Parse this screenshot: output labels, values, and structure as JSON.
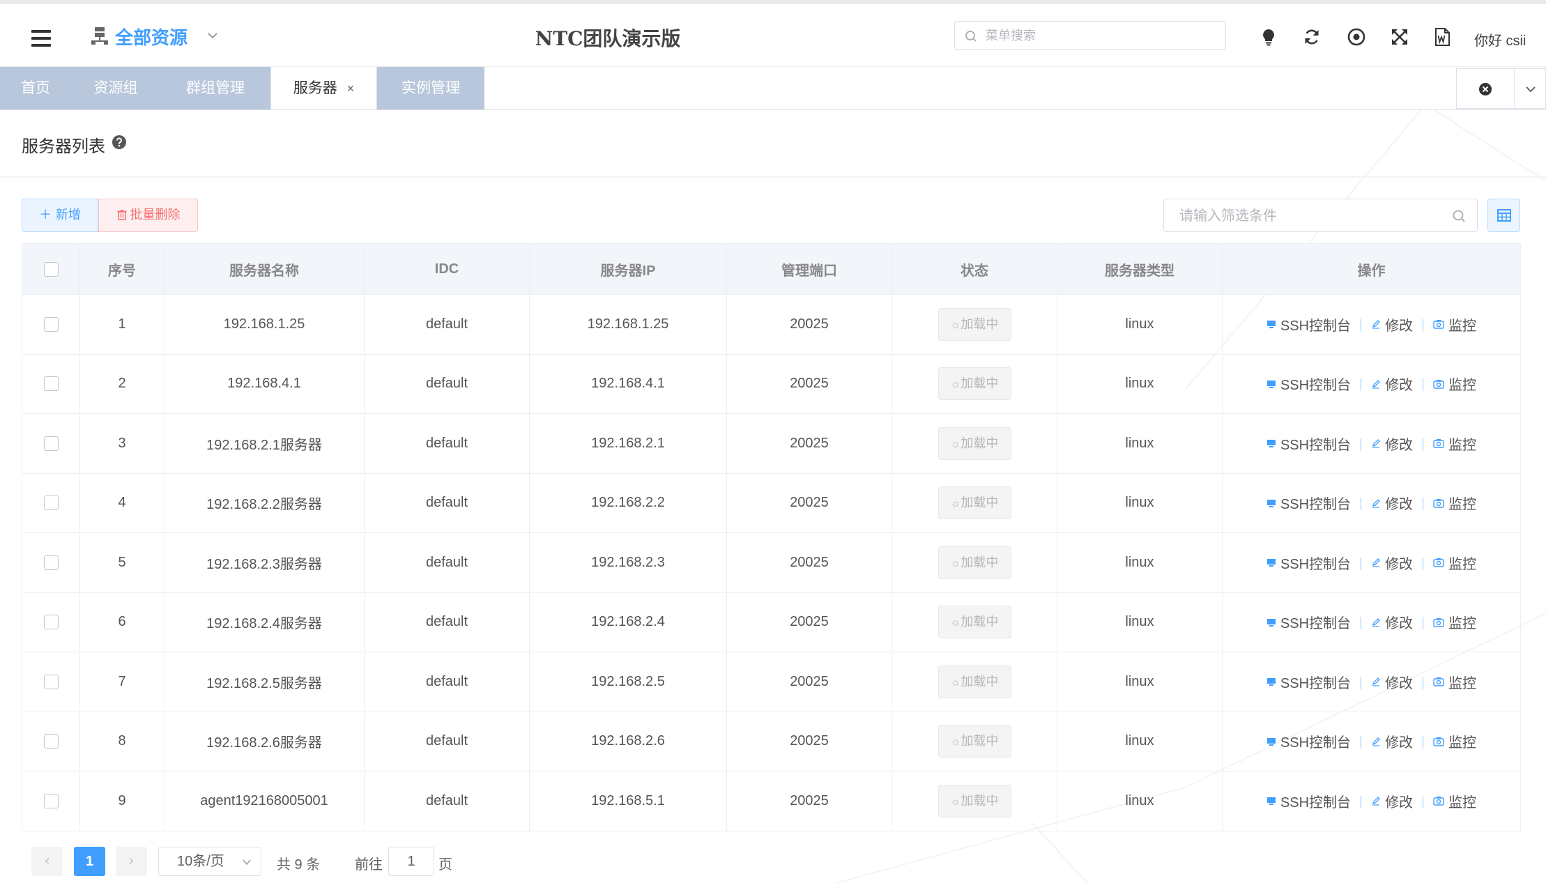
{
  "header": {
    "resource_title": "全部资源",
    "app_title": "NTC团队演示版",
    "search_placeholder": "菜单搜索",
    "greeting": "你好 csii"
  },
  "tabs": [
    {
      "label": "首页",
      "active": false
    },
    {
      "label": "资源组",
      "active": false
    },
    {
      "label": "群组管理",
      "active": false
    },
    {
      "label": "服务器",
      "active": true,
      "closable": true
    },
    {
      "label": "实例管理",
      "active": false
    }
  ],
  "page": {
    "title": "服务器列表"
  },
  "toolbar": {
    "add_label": "新增",
    "batch_delete_label": "批量删除",
    "filter_placeholder": "请输入筛选条件"
  },
  "table": {
    "columns": [
      "序号",
      "服务器名称",
      "IDC",
      "服务器IP",
      "管理端口",
      "状态",
      "服务器类型",
      "操作"
    ],
    "rows": [
      {
        "index": "1",
        "name": "192.168.1.25",
        "idc": "default",
        "ip": "192.168.1.25",
        "port": "20025",
        "status": "加载中",
        "type": "linux"
      },
      {
        "index": "2",
        "name": "192.168.4.1",
        "idc": "default",
        "ip": "192.168.4.1",
        "port": "20025",
        "status": "加载中",
        "type": "linux"
      },
      {
        "index": "3",
        "name": "192.168.2.1服务器",
        "idc": "default",
        "ip": "192.168.2.1",
        "port": "20025",
        "status": "加载中",
        "type": "linux"
      },
      {
        "index": "4",
        "name": "192.168.2.2服务器",
        "idc": "default",
        "ip": "192.168.2.2",
        "port": "20025",
        "status": "加载中",
        "type": "linux"
      },
      {
        "index": "5",
        "name": "192.168.2.3服务器",
        "idc": "default",
        "ip": "192.168.2.3",
        "port": "20025",
        "status": "加载中",
        "type": "linux"
      },
      {
        "index": "6",
        "name": "192.168.2.4服务器",
        "idc": "default",
        "ip": "192.168.2.4",
        "port": "20025",
        "status": "加载中",
        "type": "linux"
      },
      {
        "index": "7",
        "name": "192.168.2.5服务器",
        "idc": "default",
        "ip": "192.168.2.5",
        "port": "20025",
        "status": "加载中",
        "type": "linux"
      },
      {
        "index": "8",
        "name": "192.168.2.6服务器",
        "idc": "default",
        "ip": "192.168.2.6",
        "port": "20025",
        "status": "加载中",
        "type": "linux"
      },
      {
        "index": "9",
        "name": "agent192168005001",
        "idc": "default",
        "ip": "192.168.5.1",
        "port": "20025",
        "status": "加载中",
        "type": "linux"
      }
    ],
    "actions": {
      "ssh": "SSH控制台",
      "edit": "修改",
      "monitor": "监控"
    }
  },
  "pagination": {
    "current_page": "1",
    "page_size": "10条/页",
    "total": "共 9 条",
    "goto_prefix": "前往",
    "goto_value": "1",
    "goto_suffix": "页"
  },
  "colors": {
    "accent": "#409eff",
    "danger": "#f56c6c",
    "tab_inactive": "#b8c7dc"
  },
  "icons": [
    "menu-icon",
    "server-network-icon",
    "chevron-down-icon",
    "search-icon",
    "lightbulb-icon",
    "refresh-icon",
    "target-icon",
    "fullscreen-icon",
    "word-doc-icon",
    "close-circle-icon",
    "help-icon",
    "plus-icon",
    "trash-icon",
    "table-columns-icon",
    "monitor-icon",
    "edit-icon",
    "camera-icon",
    "loading-icon",
    "chevron-left-icon",
    "chevron-right-icon"
  ]
}
